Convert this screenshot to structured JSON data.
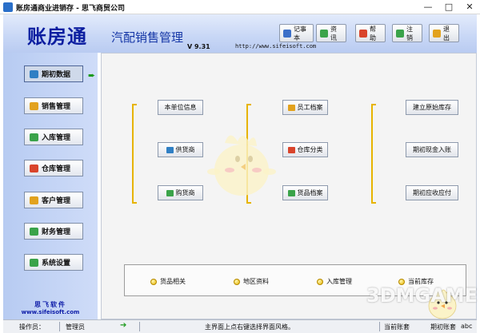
{
  "window": {
    "title": "账房通商业进销存 - 思飞商贸公司",
    "minimize": "—",
    "maximize": "□",
    "close": "✕"
  },
  "header": {
    "brand": "账房通",
    "subtitle": "汽配销售管理",
    "version": "V 9.31",
    "url": "http://www.sifeisoft.com",
    "toolbar": [
      {
        "label": "记事本",
        "icon": "notepad-icon",
        "color": "#3b6fc8"
      },
      {
        "label": "资讯",
        "icon": "info-icon",
        "color": "#3aa34a"
      },
      {
        "label": "帮助",
        "icon": "help-icon",
        "color": "#d9442b"
      },
      {
        "label": "注销",
        "icon": "logout-icon",
        "color": "#3aa34a"
      },
      {
        "label": "退出",
        "icon": "exit-icon",
        "color": "#e2a21e"
      }
    ]
  },
  "nav": {
    "items": [
      {
        "label": "期初数据",
        "icon": "data-icon",
        "color": "#2f7fc4",
        "active": true
      },
      {
        "label": "销售管理",
        "icon": "sales-icon",
        "color": "#e2a21e"
      },
      {
        "label": "入库管理",
        "icon": "inbound-icon",
        "color": "#3aa34a"
      },
      {
        "label": "仓库管理",
        "icon": "warehouse-icon",
        "color": "#d9442b"
      },
      {
        "label": "客户管理",
        "icon": "customer-icon",
        "color": "#e2a21e"
      },
      {
        "label": "财务管理",
        "icon": "finance-icon",
        "color": "#3aa34a"
      },
      {
        "label": "系统设置",
        "icon": "settings-icon",
        "color": "#3aa34a"
      }
    ],
    "arrow": "➨",
    "footer_cn": "思飞软件",
    "footer_en": "www.sifeisoft.com"
  },
  "main": {
    "col1": [
      {
        "label": "本单位信息",
        "icon": "",
        "color": ""
      },
      {
        "label": "供货商",
        "icon": "supplier-icon",
        "color": "#2f7fc4"
      },
      {
        "label": "购货商",
        "icon": "buyer-icon",
        "color": "#3aa34a"
      }
    ],
    "col2": [
      {
        "label": "员工档案",
        "icon": "employee-icon",
        "color": "#e2a21e"
      },
      {
        "label": "仓库分类",
        "icon": "category-icon",
        "color": "#d9442b"
      },
      {
        "label": "货品档案",
        "icon": "goods-icon",
        "color": "#3aa34a"
      }
    ],
    "col3": [
      {
        "label": "建立原始库存",
        "icon": "",
        "color": ""
      },
      {
        "label": "期初现金入账",
        "icon": "",
        "color": ""
      },
      {
        "label": "期初应收应付",
        "icon": "",
        "color": ""
      }
    ],
    "quick_links": [
      "货品相关",
      "地区资料",
      "入库管理",
      "当前库存"
    ]
  },
  "status": {
    "operator_label": "操作员：",
    "operator": "管理员",
    "hint": "主界面上点右键选择界面风格。",
    "right1": "当前账套",
    "right2": "期初账套",
    "right3": "abc"
  },
  "watermark": "3DMGAME",
  "colors": {
    "brand": "#0c1ea0",
    "bracket": "#e7b400",
    "accent_green": "#1d9a1d"
  }
}
